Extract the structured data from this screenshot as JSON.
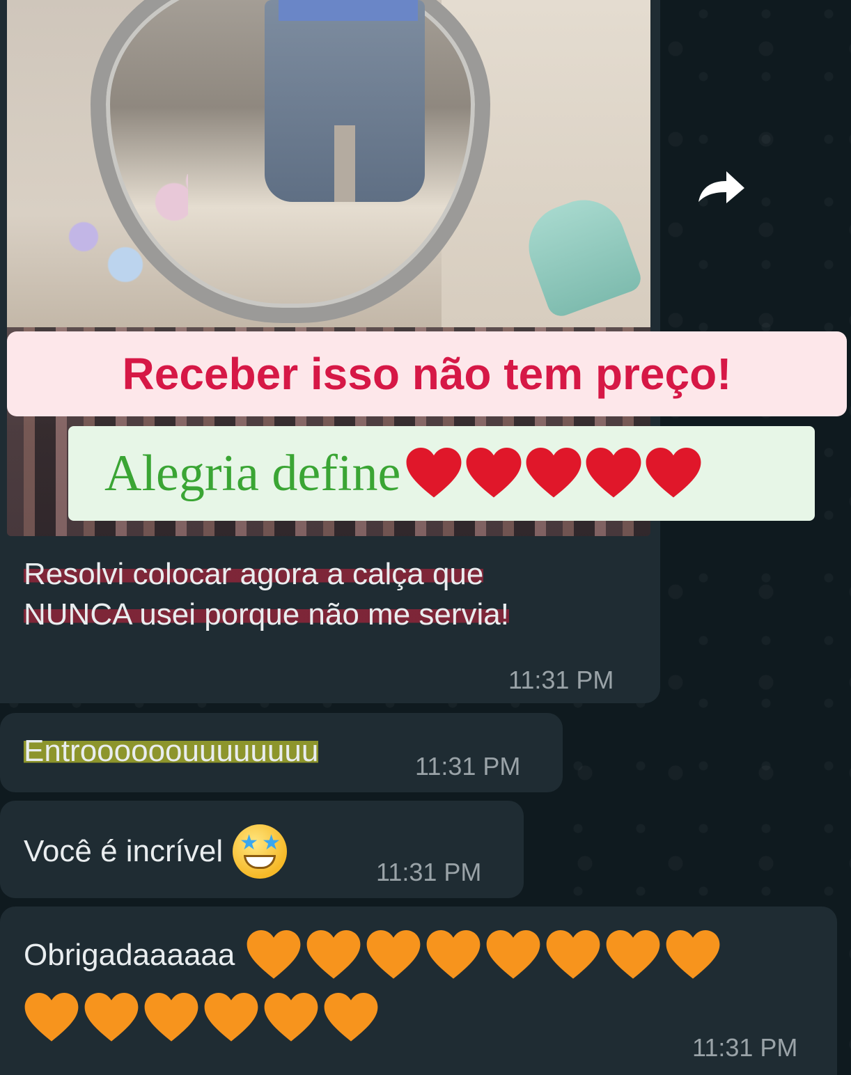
{
  "overlay": {
    "headline": "Receber isso não tem preço!",
    "subline": "Alegria define",
    "subline_hearts": [
      "❤️",
      "❤️",
      "❤️",
      "❤️",
      "❤️"
    ]
  },
  "messages": [
    {
      "id": "m1",
      "text_line1": "Resolvi colocar agora a calça que",
      "text_line2": "NUNCA usei porque não me servia!",
      "time": "11:31 PM"
    },
    {
      "id": "m2",
      "text": "Entroooooouuuuuuuu",
      "time": "11:31 PM"
    },
    {
      "id": "m3",
      "text": "Você é incrível",
      "emoji": "star-struck",
      "time": "11:31 PM"
    },
    {
      "id": "m4",
      "text": "Obrigadaaaaaa",
      "hearts_count": 14,
      "heart_color": "#f7941d",
      "time": "11:31 PM"
    }
  ],
  "icons": {
    "forward": "forward-arrow-icon"
  },
  "colors": {
    "bubble": "#1f2c33",
    "headline": "#d61846",
    "subline": "#3aa534",
    "timestamp": "#9aa3a8"
  }
}
